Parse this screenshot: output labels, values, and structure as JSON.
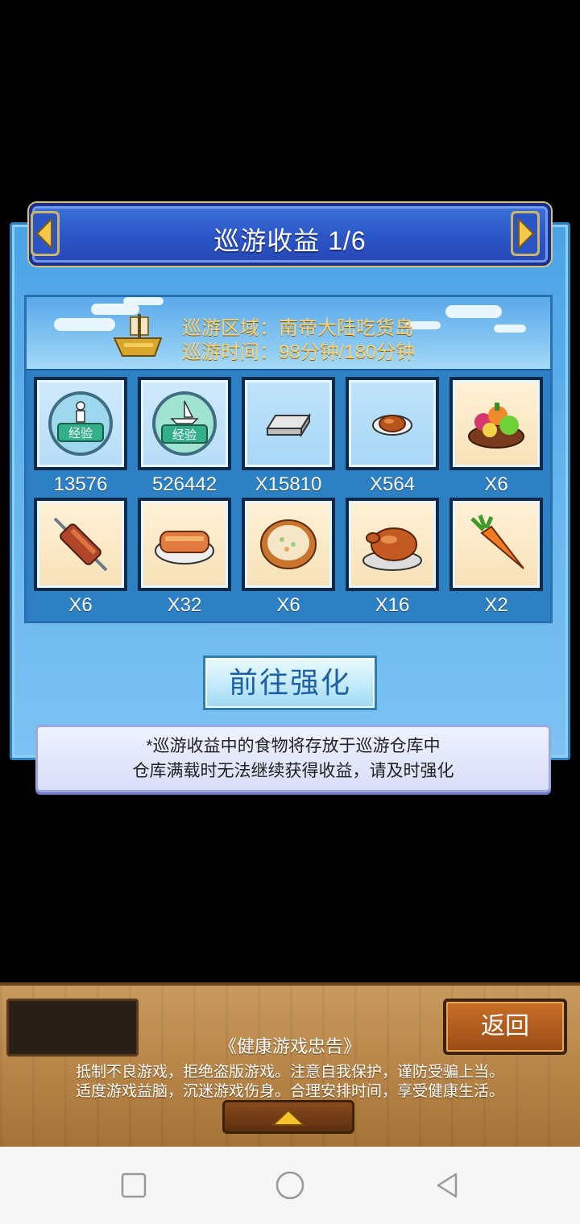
{
  "header": {
    "title": "巡游收益 1/6"
  },
  "cruise": {
    "area_label": "巡游区域：南帝大陆吃货岛",
    "time_label": "巡游时间：98分钟/180分钟"
  },
  "rewards": [
    {
      "icon": "exp-person-icon",
      "qty": "13576"
    },
    {
      "icon": "exp-ship-icon",
      "qty": "526442"
    },
    {
      "icon": "silver-bar-icon",
      "qty": "X15810"
    },
    {
      "icon": "roast-meat-icon",
      "qty": "X564"
    },
    {
      "icon": "fruit-basket-icon",
      "qty": "X6"
    },
    {
      "icon": "meat-skewer-icon",
      "qty": "X6"
    },
    {
      "icon": "grilled-fish-icon",
      "qty": "X32"
    },
    {
      "icon": "soup-bowl-icon",
      "qty": "X6"
    },
    {
      "icon": "roast-chicken-icon",
      "qty": "X16"
    },
    {
      "icon": "carrot-icon",
      "qty": "X2"
    }
  ],
  "buttons": {
    "go_strengthen": "前往强化",
    "back": "返回"
  },
  "notice": {
    "line1": "*巡游收益中的食物将存放于巡游仓库中",
    "line2": "仓库满载时无法继续获得收益，请及时强化"
  },
  "health": {
    "title": "《健康游戏忠告》",
    "line1": "抵制不良游戏，拒绝盗版游戏。注意自我保护，谨防受骗上当。",
    "line2": "适度游戏益脑，沉迷游戏伤身。合理安排时间，享受健康生活。"
  },
  "colors": {
    "panel": "#4aa3e6",
    "title_bar": "#2b55c7",
    "gold_text": "#f7d27a",
    "wood": "#b88648"
  }
}
